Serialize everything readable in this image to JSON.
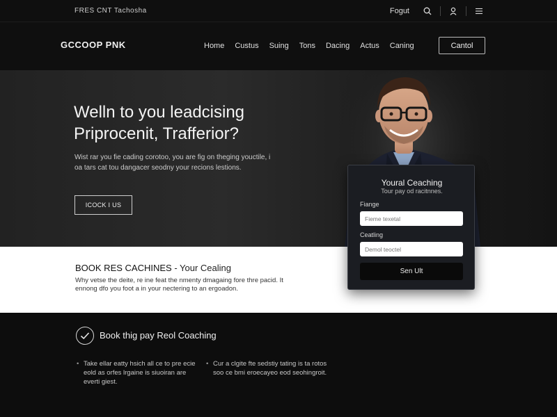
{
  "topbar": {
    "tagline": "FRES CNT Tachosha",
    "login": "Fogut",
    "icons": [
      "search-icon",
      "user-icon",
      "menu-icon"
    ]
  },
  "nav": {
    "logo": "GCCOOP PNK",
    "menu": [
      "Home",
      "Custus",
      "Suing",
      "Tons",
      "Dacing",
      "Actus",
      "Caning"
    ],
    "contact_label": "Cantol"
  },
  "hero": {
    "title_line1": "Welln to you leadcising",
    "title_line2": "Priprocenit, Trafferior?",
    "desc": "Wist rar you fie cading corotoo, you are fig on theging youctile, i oa tars cat tou dangacer seodny your recions lestions.",
    "cta": "ICOCK I US"
  },
  "form": {
    "title": "Youral Ceaching",
    "subtitle": "Tour pay od racitnnes.",
    "label1": "Fiange",
    "placeholder1": "Fieme texetal",
    "label2": "Ceatling",
    "placeholder2": "Demol teoctel",
    "submit": "Sen Ult"
  },
  "band": {
    "heading_bold": "BOOK RES CACHINES",
    "heading_light": " - Your Cealing",
    "body": "Why vetse the deite, re ine feat the nmenty dmagaing fore thre pacid. It ennong dfo you foot a in your nectering to an ergoadon."
  },
  "lower": {
    "heading": "Book thig pay Reol Coaching",
    "col1": "Take ellar eatty hsich all ce to pre ecie eold as orfes lrgaine is siuoiran are everti giest.",
    "col2": "Cur a clgite fte sedstiy tating is ta rotos soo ce bmi eroecayeo eod seohingroit."
  },
  "colors": {
    "background": "#0d0d0d",
    "hero_bg": "#262626",
    "band_bg": "#ffffff",
    "card_bg": "#1b1d22"
  }
}
